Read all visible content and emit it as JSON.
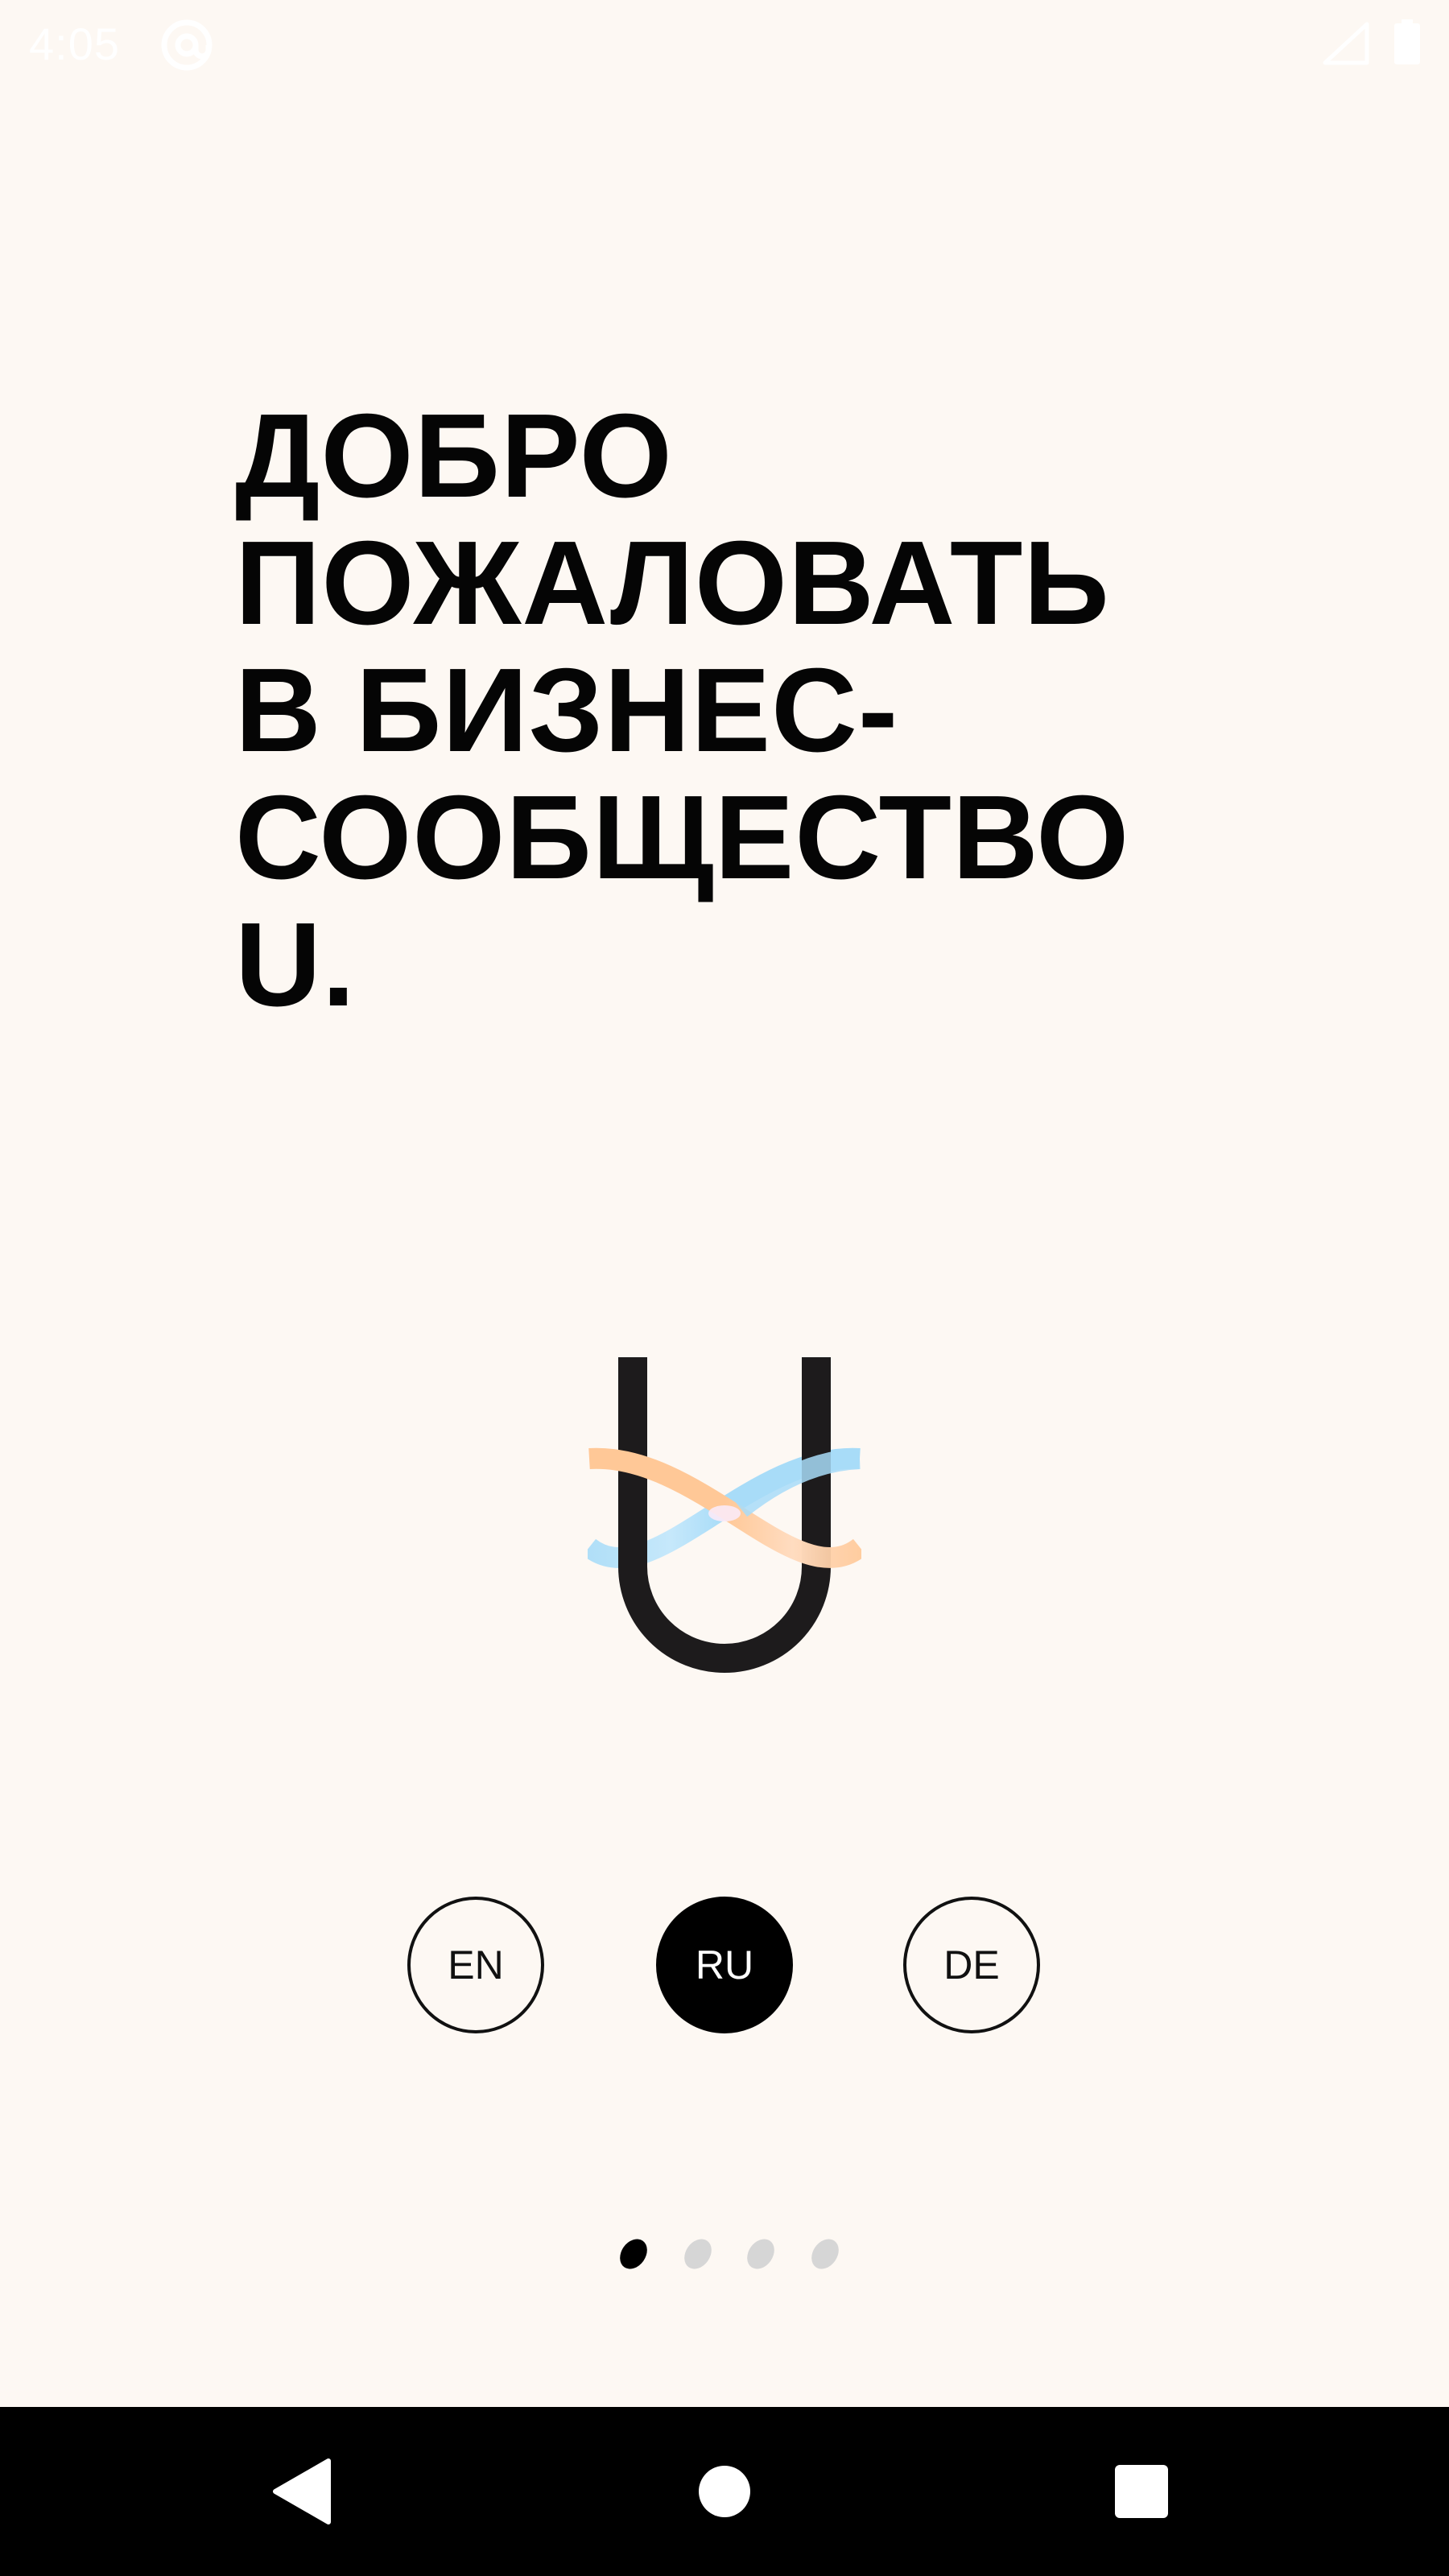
{
  "status_bar": {
    "time": "4:05",
    "icons": [
      "at-sign-icon",
      "signal-icon",
      "battery-icon"
    ]
  },
  "welcome": {
    "title_lines": [
      "ДОБРО",
      "ПОЖАЛОВАТЬ",
      "В БИЗНЕС-",
      "СООБЩЕСТВО",
      "U."
    ]
  },
  "logo": {
    "icon": "u-logo-icon",
    "colors": {
      "letter": "#1a1a1a",
      "orange_ring": "#ffc897",
      "blue_ring": "#a8dcf8"
    }
  },
  "languages": {
    "options": [
      "EN",
      "RU",
      "DE"
    ],
    "selected": "RU"
  },
  "pager": {
    "total": 4,
    "current": 1
  },
  "nav_bar": {
    "icons": [
      "back-icon",
      "home-icon",
      "recents-icon"
    ]
  },
  "colors": {
    "background": "#fdf8f3",
    "text": "#050505",
    "accent": "#000000",
    "inactive_dot": "#d6d6d6"
  }
}
